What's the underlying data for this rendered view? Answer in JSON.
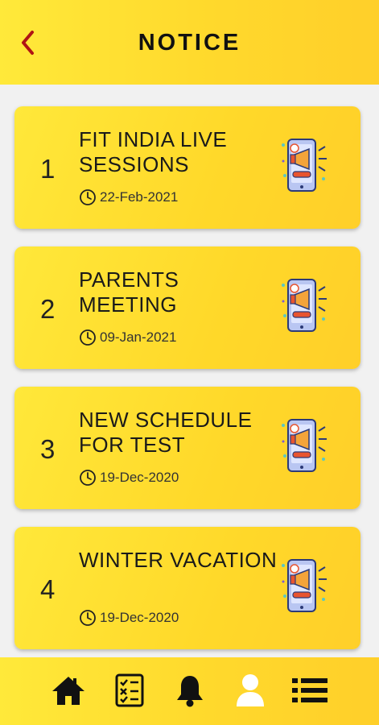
{
  "header": {
    "title": "NOTICE",
    "back_icon": "chevron-left-icon"
  },
  "notices": [
    {
      "number": "1",
      "title": "FIT INDIA LIVE SESSIONS",
      "date": "22-Feb-2021"
    },
    {
      "number": "2",
      "title": "PARENTS MEETING",
      "date": "09-Jan-2021"
    },
    {
      "number": "3",
      "title": "NEW SCHEDULE FOR TEST",
      "date": "19-Dec-2020"
    },
    {
      "number": "4",
      "title": "WINTER VACATION",
      "date": "19-Dec-2020"
    }
  ],
  "bottom_nav": {
    "items": [
      {
        "icon": "home-icon"
      },
      {
        "icon": "checklist-icon"
      },
      {
        "icon": "bell-icon"
      },
      {
        "icon": "user-icon",
        "active": true
      },
      {
        "icon": "list-icon"
      }
    ]
  },
  "colors": {
    "accent_yellow": "#ffd92c",
    "back_arrow": "#b01414",
    "active_nav": "#ffffff",
    "inactive_nav": "#111111"
  }
}
